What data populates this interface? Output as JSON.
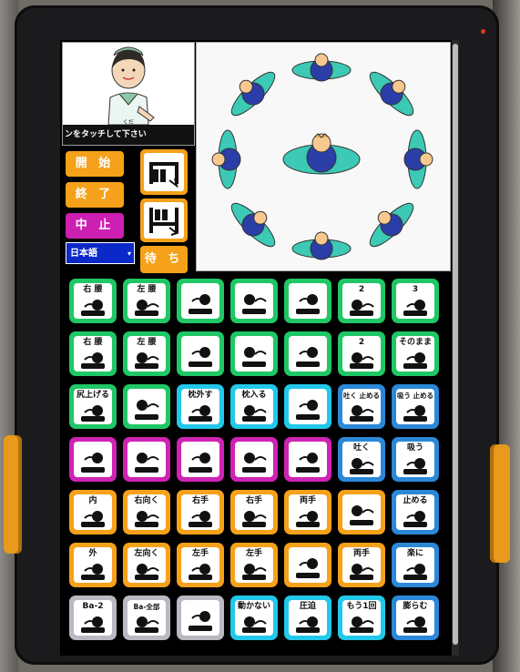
{
  "assist": {
    "caption": "ンをタッチして下さい",
    "ruby": "くだ"
  },
  "controls": {
    "start": "開 始",
    "end": "終 了",
    "stop": "中 止",
    "wait": "待 ち",
    "language": "日本語"
  },
  "colors": {
    "green": "#1fc765",
    "magenta": "#cf23b3",
    "blue": "#2b88d8",
    "orange": "#f6a11a",
    "cyan": "#22c8ea",
    "gray": "#b9b9c2",
    "language_bg": "#0b28c8"
  },
  "grid": {
    "rows": [
      [
        {
          "label": "右 腰",
          "icon": "hip-right-icon"
        },
        {
          "label": "左 腰",
          "icon": "hip-left-icon"
        },
        {
          "label": "",
          "icon": "turn-body-icon"
        },
        {
          "label": "",
          "icon": "turn-body-back-icon"
        },
        {
          "label": "",
          "icon": "head-turn-icon"
        },
        {
          "label": "2",
          "icon": "head-turn-2-icon"
        },
        {
          "label": "3",
          "icon": "head-turn-3-icon"
        }
      ],
      [
        {
          "label": "右 腰",
          "icon": "hip-right-down-icon"
        },
        {
          "label": "左 腰",
          "icon": "hip-left-down-icon"
        },
        {
          "label": "",
          "icon": "reverse-turn-icon"
        },
        {
          "label": "",
          "icon": "reverse-turn-back-icon"
        },
        {
          "label": "",
          "icon": "head-reverse-icon"
        },
        {
          "label": "2",
          "icon": "head-reverse-2-icon"
        },
        {
          "label": "そのまま",
          "icon": "hand-stay-icon"
        }
      ],
      [
        {
          "label": "尻上げる",
          "icon": "raise-hip-icon"
        },
        {
          "label": "",
          "icon": "raise-head-icon"
        },
        {
          "label": "枕外す",
          "icon": "remove-pillow-icon"
        },
        {
          "label": "枕入る",
          "icon": "insert-pillow-icon"
        },
        {
          "label": "",
          "icon": "bed-down-icon"
        },
        {
          "label": "吐く 止める",
          "icon": "exhale-stop-icon"
        },
        {
          "label": "吸う 止める",
          "icon": "inhale-stop-icon"
        }
      ],
      [
        {
          "label": "",
          "icon": "bed-tilt-icon"
        },
        {
          "label": "",
          "icon": "bed-flat-icon"
        },
        {
          "label": "",
          "icon": "bed-incline-icon"
        },
        {
          "label": "",
          "icon": "stand-icon"
        },
        {
          "label": "",
          "icon": "scanner-icon"
        },
        {
          "label": "吐く",
          "icon": "exhale-icon"
        },
        {
          "label": "吸う",
          "icon": "inhale-icon"
        }
      ],
      [
        {
          "label": "内",
          "icon": "arm-inward-icon"
        },
        {
          "label": "右向く",
          "icon": "face-right-icon"
        },
        {
          "label": "右手",
          "icon": "right-hand-up-icon"
        },
        {
          "label": "右手",
          "icon": "right-hand-raise-icon"
        },
        {
          "label": "両手",
          "icon": "both-hands-icon"
        },
        {
          "label": "",
          "icon": "leg-raise-icon"
        },
        {
          "label": "止める",
          "icon": "stop-breath-icon"
        }
      ],
      [
        {
          "label": "外",
          "icon": "arm-outward-icon"
        },
        {
          "label": "左向く",
          "icon": "face-left-icon"
        },
        {
          "label": "左手",
          "icon": "left-hand-down-icon"
        },
        {
          "label": "左手",
          "icon": "left-hand-raise-icon"
        },
        {
          "label": "",
          "icon": "arms-out-icon"
        },
        {
          "label": "両手",
          "icon": "both-hands-down-icon"
        },
        {
          "label": "楽に",
          "icon": "relax-icon"
        }
      ],
      [
        {
          "label": "Ba-2",
          "icon": "barium-2-icon"
        },
        {
          "label": "Ba-全部",
          "icon": "barium-all-icon"
        },
        {
          "label": "",
          "icon": "drink-icon"
        },
        {
          "label": "動かない",
          "icon": "dont-move-icon"
        },
        {
          "label": "圧迫",
          "icon": "compress-icon"
        },
        {
          "label": "もう1回",
          "icon": "once-more-icon"
        },
        {
          "label": "膨らむ",
          "icon": "inflate-icon"
        }
      ]
    ]
  }
}
